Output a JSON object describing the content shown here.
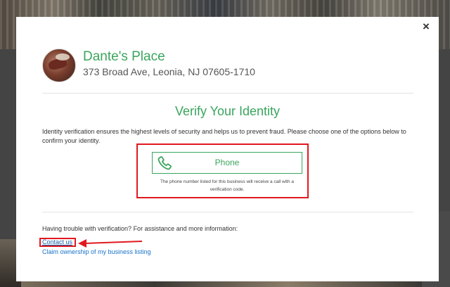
{
  "business": {
    "name": "Dante's Place",
    "address": "373 Broad Ave, Leonia, NJ 07605-1710"
  },
  "modal": {
    "close_glyph": "×",
    "title": "Verify Your Identity",
    "description": "Identity verification ensures the highest levels of security and helps us to prevent fraud. Please choose one of the options below to confirm your identity."
  },
  "options": {
    "phone": {
      "label": "Phone",
      "icon": "phone-icon",
      "note": "The phone number listed for this business will receive a call with a verification code."
    }
  },
  "help": {
    "trouble_text": "Having trouble with verification? For assistance and more information:",
    "contact_label": "Contact us",
    "claim_label": "Claim ownership of my business listing"
  },
  "colors": {
    "accent_green": "#3aa55d",
    "highlight_red": "#e0191f",
    "link_blue": "#1a73c8"
  }
}
